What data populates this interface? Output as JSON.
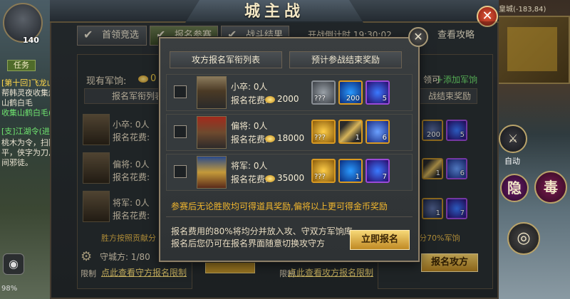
{
  "window": {
    "title": "城主战",
    "close_icon": "close-icon"
  },
  "tabs": [
    {
      "label": "首领竞选"
    },
    {
      "label": "报名参赛"
    },
    {
      "label": "战斗结果"
    }
  ],
  "countdown": "开战倒计时 19:30:02",
  "view_guide": "查看攻略",
  "hud": {
    "level": "140",
    "side_tab": "任务",
    "quests": [
      "[第十回]飞龙山寨",
      "帮韩灵夜收集炼",
      "山鹤白毛",
      "收集山鹤白毛(0/",
      "[支]江湖令(进)",
      "桃木为令，扫除",
      "平，侠字为刀,",
      "间邪徒。"
    ],
    "battery": "98%",
    "minimap_coord": "皇城(-183,84)",
    "auto_label": "自动",
    "skill_yin": "隐",
    "skill_du": "毒"
  },
  "left_panel": {
    "current_label": "现有军饷:",
    "current_value": "0",
    "list_title": "报名军衔列表",
    "rows": [
      {
        "rank": "小卒: 0人",
        "fee": "报名花费:"
      },
      {
        "rank": "偏将: 0人",
        "fee": "报名花费:"
      },
      {
        "rank": "将军: 0人",
        "fee": "报名花费:"
      }
    ],
    "hint": "胜方按照贡献分",
    "defense_label": "守城方: 1/80",
    "limit": "限制",
    "defense_link": "点此查看守方报名限制"
  },
  "right_panel": {
    "top_text": "领可",
    "add_link": "+添加军饷",
    "subhead": "战结束奖励",
    "hint": "分70%军饷",
    "limit": "限制",
    "attack_link": "点此查看攻方报名限制",
    "attack_button": "报名攻方",
    "item_counts": [
      "200",
      "5",
      "1",
      "6",
      "1",
      "7"
    ]
  },
  "modal": {
    "col1": "攻方报名军衔列表",
    "col2": "预计参战结束奖励",
    "rows": [
      {
        "rank": "小卒: 0人",
        "fee_label": "报名花费:",
        "fee": "2000",
        "items": [
          {
            "icon": "silver-ore-icon",
            "q": "???",
            "n": ""
          },
          {
            "icon": "blue-orb-icon",
            "q": "",
            "n": "200"
          },
          {
            "icon": "purple-gem-icon",
            "q": "",
            "n": "5"
          }
        ]
      },
      {
        "rank": "偏将: 0人",
        "fee_label": "报名花费:",
        "fee": "18000",
        "items": [
          {
            "icon": "gold-ore-icon",
            "q": "???",
            "n": ""
          },
          {
            "icon": "gold-knife-icon",
            "q": "",
            "n": "1"
          },
          {
            "icon": "blue-gem-icon",
            "q": "",
            "n": "6"
          }
        ]
      },
      {
        "rank": "将军: 0人",
        "fee_label": "报名花费:",
        "fee": "35000",
        "items": [
          {
            "icon": "gold-ore-icon",
            "q": "???",
            "n": ""
          },
          {
            "icon": "blue-stone-icon",
            "q": "",
            "n": "1"
          },
          {
            "icon": "purple-gem-icon",
            "q": "",
            "n": "7"
          }
        ]
      }
    ],
    "notice": "参赛后无论胜败均可得道具奖励,偏将以上更可得金币奖励",
    "info_line1": "报名费用的80%将均分并放入攻、守双方军饷库",
    "info_line2": "报名后您仍可在报名界面随意切换攻守方",
    "register_button": "立即报名"
  }
}
